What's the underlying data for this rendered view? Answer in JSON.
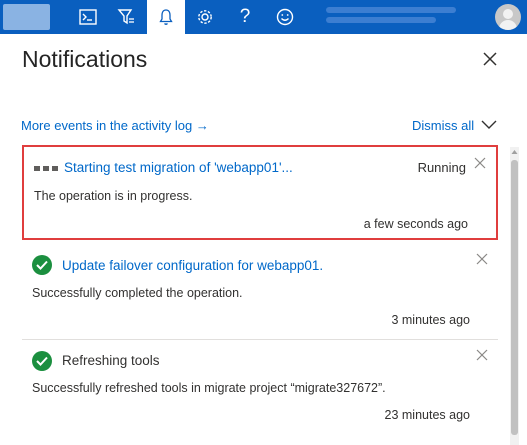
{
  "topbar": {
    "icons": [
      "cloud-shell-icon",
      "directory-filter-icon",
      "notifications-bell-icon",
      "settings-gear-icon",
      "help-icon",
      "feedback-smiley-icon"
    ]
  },
  "panel": {
    "title": "Notifications",
    "more_events_link": "More events in the activity log →",
    "dismiss_all": "Dismiss all"
  },
  "notifications": [
    {
      "title": "Starting test migration of 'webapp01'...",
      "status": "Running",
      "description": "The operation is in progress.",
      "time": "a few seconds ago",
      "icon": "in-progress-dots-icon"
    },
    {
      "title": "Update failover configuration for webapp01.",
      "status": "",
      "description": "Successfully completed the operation.",
      "time": "3 minutes ago",
      "icon": "success-check-icon"
    },
    {
      "title": "Refreshing tools",
      "status": "",
      "description": "Successfully refreshed tools in migrate project “migrate327672”.",
      "time": "23 minutes ago",
      "icon": "success-check-icon"
    }
  ],
  "colors": {
    "topbar": "#0a5fbf",
    "link": "#0068c9",
    "success": "#1b8f3f",
    "highlight_border": "#e03e3e"
  }
}
